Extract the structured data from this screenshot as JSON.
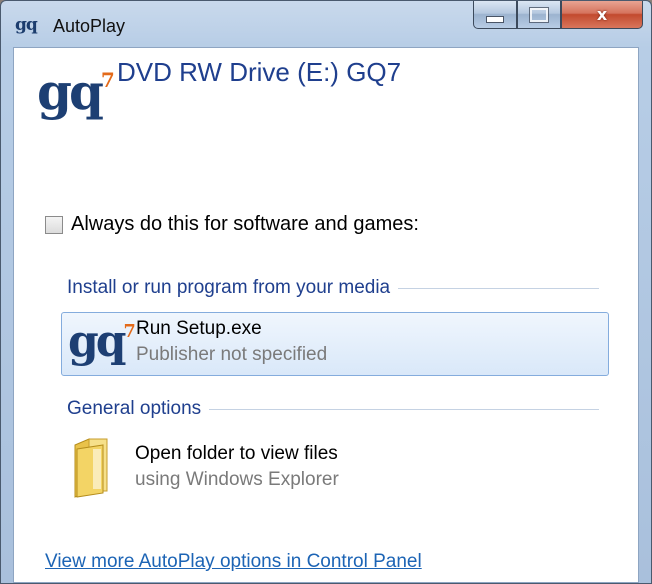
{
  "window": {
    "title": "AutoPlay",
    "title_logo": "gq",
    "close_glyph": "x"
  },
  "header": {
    "logo_text": "gq",
    "logo_sup": "7",
    "drive_title": "DVD RW Drive (E:) GQ7"
  },
  "checkbox": {
    "label": "Always do this for software and games:",
    "checked": false
  },
  "sections": {
    "install": {
      "title": "Install or run program from your media",
      "option": {
        "logo_text": "gq",
        "logo_sup": "7",
        "title": "Run Setup.exe",
        "subtitle": "Publisher not specified"
      }
    },
    "general": {
      "title": "General options",
      "option": {
        "icon": "folder-icon",
        "title": "Open folder to view files",
        "subtitle": "using Windows Explorer"
      }
    }
  },
  "footer": {
    "link": "View more AutoPlay options in Control Panel"
  },
  "colors": {
    "accent_blue": "#1f3f8e",
    "link_blue": "#1c64b5",
    "logo_orange": "#e36a1a",
    "selection_bg": "#d9e8f9"
  }
}
